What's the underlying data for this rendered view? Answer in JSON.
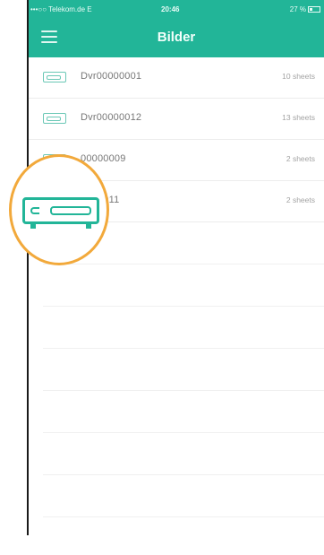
{
  "status_bar": {
    "carrier": "•••○○ Telekom.de",
    "network": "E",
    "time": "20:46",
    "battery_percent": "27 %"
  },
  "nav": {
    "title": "Bilder",
    "menu_icon": "hamburger-menu-icon"
  },
  "devices": [
    {
      "name": "Dvr00000001",
      "sheets": "10 sheets"
    },
    {
      "name": "Dvr00000012",
      "sheets": "13 sheets"
    },
    {
      "name": "Dvr00000009",
      "sheets": "2 sheets"
    },
    {
      "name": "Dvr00000011",
      "sheets": "2 sheets"
    }
  ],
  "visible_device_names": [
    "Dvr00000001",
    "Dvr00000012",
    "00000009",
    "0000011"
  ],
  "highlight": {
    "icon": "dvr-device-icon",
    "accent_color": "#22b598",
    "ring_color": "#f2a93b"
  }
}
